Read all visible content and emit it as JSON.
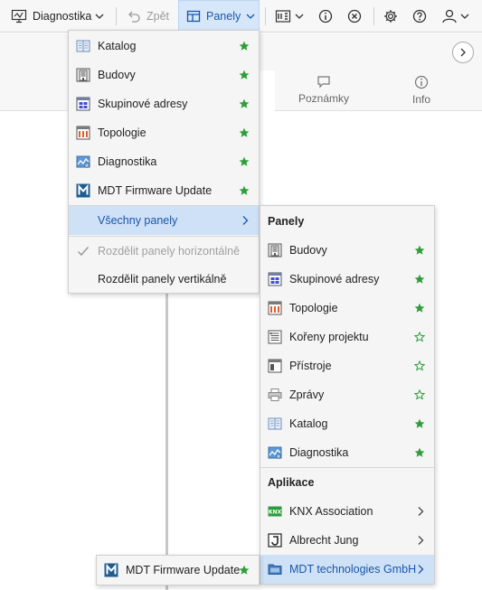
{
  "toolbar": {
    "diagnostika_label": "Diagnostika",
    "back_label": "Zpět",
    "panely_label": "Panely"
  },
  "background": {
    "tabs": [
      {
        "label": "Poznámky",
        "icon": "comment-icon"
      },
      {
        "label": "Info",
        "icon": "info-icon"
      }
    ]
  },
  "menu_main": {
    "items": [
      {
        "label": "Katalog",
        "icon": "catalog-icon",
        "favorite": true
      },
      {
        "label": "Budovy",
        "icon": "buildings-icon",
        "favorite": true
      },
      {
        "label": "Skupinové adresy",
        "icon": "group-addresses-icon",
        "favorite": true
      },
      {
        "label": "Topologie",
        "icon": "topology-icon",
        "favorite": true
      },
      {
        "label": "Diagnostika",
        "icon": "diagnostics-icon",
        "favorite": true
      },
      {
        "label": "MDT Firmware Update",
        "icon": "mdt-icon",
        "favorite": true
      }
    ],
    "all_panels_label": "Všechny panely",
    "split_horizontal_label": "Rozdělit panely horizontálně",
    "split_vertical_label": "Rozdělit panely vertikálně"
  },
  "menu_all": {
    "panels_header": "Panely",
    "panels": [
      {
        "label": "Budovy",
        "icon": "buildings-icon",
        "favorite": true
      },
      {
        "label": "Skupinové adresy",
        "icon": "group-addresses-icon",
        "favorite": true
      },
      {
        "label": "Topologie",
        "icon": "topology-icon",
        "favorite": true
      },
      {
        "label": "Kořeny projektu",
        "icon": "project-roots-icon",
        "favorite": false
      },
      {
        "label": "Přístroje",
        "icon": "devices-icon",
        "favorite": false
      },
      {
        "label": "Zprávy",
        "icon": "printer-icon",
        "favorite": false
      },
      {
        "label": "Katalog",
        "icon": "catalog-icon",
        "favorite": true
      },
      {
        "label": "Diagnostika",
        "icon": "diagnostics-icon",
        "favorite": true
      }
    ],
    "apps_header": "Aplikace",
    "apps": [
      {
        "label": "KNX Association",
        "icon": "knx-icon"
      },
      {
        "label": "Albrecht Jung",
        "icon": "jung-icon"
      },
      {
        "label": "MDT technologies GmbH",
        "icon": "mdt-folder-icon"
      }
    ]
  },
  "menu_mdt": {
    "items": [
      {
        "label": "MDT Firmware Update",
        "icon": "mdt-icon",
        "favorite": true
      }
    ]
  },
  "colors": {
    "accent": "#1a56a8",
    "highlight": "#cfe1f7",
    "star_green": "#2e9e3a"
  }
}
